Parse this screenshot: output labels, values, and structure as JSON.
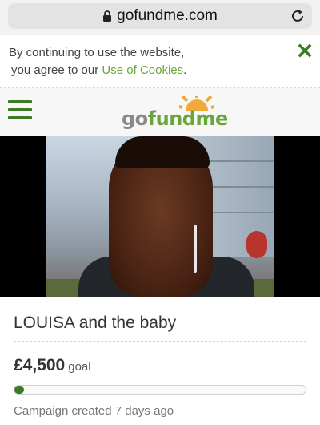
{
  "browser": {
    "url": "gofundme.com"
  },
  "cookie_banner": {
    "line1": "By continuing to use the website,",
    "line2_prefix": "you agree to our ",
    "link": "Use of Cookies",
    "line2_suffix": "."
  },
  "header": {
    "logo_go": "go",
    "logo_fund": "fundme"
  },
  "campaign": {
    "title": "LOUISA and the baby",
    "goal_amount": "£4,500",
    "goal_label": "goal",
    "progress_fraction": 0.03,
    "created": "Campaign created 7 days ago"
  },
  "colors": {
    "brand_green": "#3d7a25",
    "link_green": "#6aa43a"
  }
}
